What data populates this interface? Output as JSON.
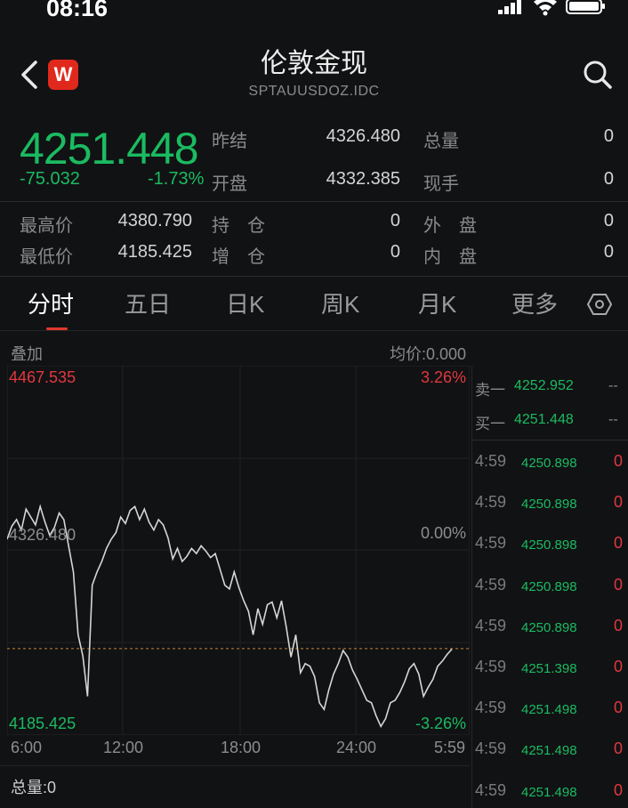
{
  "status": {
    "time": "08:16"
  },
  "header": {
    "title": "伦敦金现",
    "subtitle": "SPTAUUSDOZ.IDC",
    "logo_text": "W"
  },
  "quote": {
    "price": "4251.448",
    "change": "-75.032",
    "change_pct": "-1.73%"
  },
  "stats": [
    {
      "label": "昨结",
      "value": "4326.480"
    },
    {
      "label": "开盘",
      "value": "4332.385"
    },
    {
      "label": "总量",
      "value": "0"
    },
    {
      "label": "现手",
      "value": "0"
    },
    {
      "label": "最高价",
      "value": "4380.790"
    },
    {
      "label": "最低价",
      "value": "4185.425"
    },
    {
      "label": "持　仓",
      "value": "0"
    },
    {
      "label": "增　仓",
      "value": "0"
    },
    {
      "label": "外　盘",
      "value": "0"
    },
    {
      "label": "内　盘",
      "value": "0"
    }
  ],
  "tabs": [
    "分时",
    "五日",
    "日K",
    "周K",
    "月K",
    "更多"
  ],
  "chart_header": {
    "overlay": "叠加",
    "avg": "均价:0.000"
  },
  "chart_data": {
    "type": "line",
    "y_top_label": "4467.535",
    "y_mid_label": "4326.480",
    "y_bottom_label": "4185.425",
    "pct_top": "3.26%",
    "pct_mid": "0.00%",
    "pct_bottom": "-3.26%",
    "x_labels": [
      "6:00",
      "12:00",
      "18:00",
      "24:00",
      "5:59"
    ],
    "ylim": [
      4185.425,
      4467.535
    ],
    "reference_price": 4326.48,
    "current_price": 4251.448,
    "series": [
      {
        "values": [
          4335,
          4345,
          4350,
          4342,
          4358,
          4352,
          4346,
          4360,
          4348,
          4338,
          4344,
          4355,
          4350,
          4330,
          4310,
          4262,
          4246,
          4215,
          4300,
          4310,
          4318,
          4328,
          4335,
          4340,
          4352,
          4347,
          4357,
          4360,
          4350,
          4358,
          4348,
          4342,
          4350,
          4346,
          4336,
          4320,
          4328,
          4318,
          4322,
          4328,
          4324,
          4330,
          4326,
          4321,
          4324,
          4312,
          4300,
          4297,
          4310,
          4298,
          4288,
          4280,
          4262,
          4282,
          4270,
          4285,
          4287,
          4275,
          4288,
          4268,
          4245,
          4262,
          4233,
          4240,
          4238,
          4230,
          4210,
          4205,
          4220,
          4232,
          4240,
          4250,
          4245,
          4235,
          4228,
          4220,
          4212,
          4210,
          4200,
          4192,
          4198,
          4210,
          4212,
          4218,
          4226,
          4236,
          4240,
          4232,
          4215,
          4222,
          4228,
          4238,
          4242,
          4247,
          4251
        ]
      }
    ]
  },
  "order_book": [
    {
      "label": "卖一",
      "price": "4252.952",
      "vol": "--"
    },
    {
      "label": "买一",
      "price": "4251.448",
      "vol": "--"
    }
  ],
  "ticks": [
    {
      "time": "4:59",
      "price": "4250.898",
      "vol": "0"
    },
    {
      "time": "4:59",
      "price": "4250.898",
      "vol": "0"
    },
    {
      "time": "4:59",
      "price": "4250.898",
      "vol": "0"
    },
    {
      "time": "4:59",
      "price": "4250.898",
      "vol": "0"
    },
    {
      "time": "4:59",
      "price": "4250.898",
      "vol": "0"
    },
    {
      "time": "4:59",
      "price": "4251.398",
      "vol": "0"
    },
    {
      "time": "4:59",
      "price": "4251.498",
      "vol": "0"
    },
    {
      "time": "4:59",
      "price": "4251.498",
      "vol": "0"
    },
    {
      "time": "4:59",
      "price": "4251.498",
      "vol": "0"
    }
  ],
  "volume": {
    "label": "总量:0"
  },
  "colors": {
    "up": "#e0383e",
    "down": "#1bbb61",
    "bg": "#111214"
  }
}
